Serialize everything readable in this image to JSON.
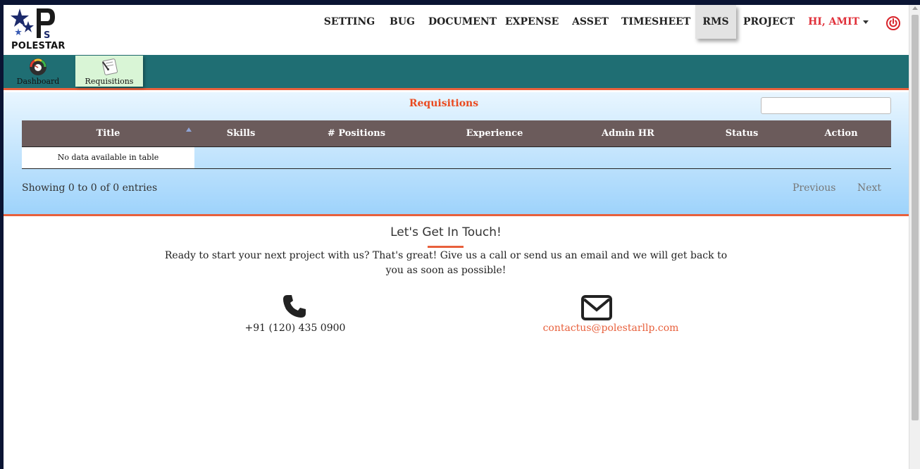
{
  "brand": {
    "logo_text": "POLESTAR"
  },
  "nav": {
    "items": [
      {
        "label": "SETTING"
      },
      {
        "label": "BUG"
      },
      {
        "label": "DOCUMENT"
      },
      {
        "label": "EXPENSE"
      },
      {
        "label": "ASSET"
      },
      {
        "label": "TIMESHEET"
      },
      {
        "label": "RMS"
      },
      {
        "label": "PROJECT"
      }
    ],
    "active": "RMS",
    "user_label": "HI, AMIT",
    "power_icon": "power-icon"
  },
  "subnav": {
    "items": [
      {
        "label": "Dashboard",
        "icon": "gauge-icon"
      },
      {
        "label": "Requisitions",
        "icon": "requisition-icon"
      }
    ],
    "active": "Requisitions"
  },
  "requisitions": {
    "title": "Requisitions",
    "search": {
      "value": "",
      "placeholder": ""
    },
    "columns": [
      "Title",
      "Skills",
      "# Positions",
      "Experience",
      "Admin HR",
      "Status",
      "Action"
    ],
    "empty_message": "No data available in table",
    "info": "Showing 0 to 0 of 0 entries",
    "previous_label": "Previous",
    "next_label": "Next"
  },
  "contact": {
    "title": "Let's Get In Touch!",
    "text": "Ready to start your next project with us? That's great! Give us a call or send us an email and we will get back to you as soon as possible!",
    "phone": "+91 (120) 435 0900",
    "email": "contactus@polestarllp.com"
  },
  "colors": {
    "accent": "#e8603c",
    "teal": "#1f6e73",
    "table_header": "#6b5b5b",
    "user_red": "#e0303a"
  }
}
